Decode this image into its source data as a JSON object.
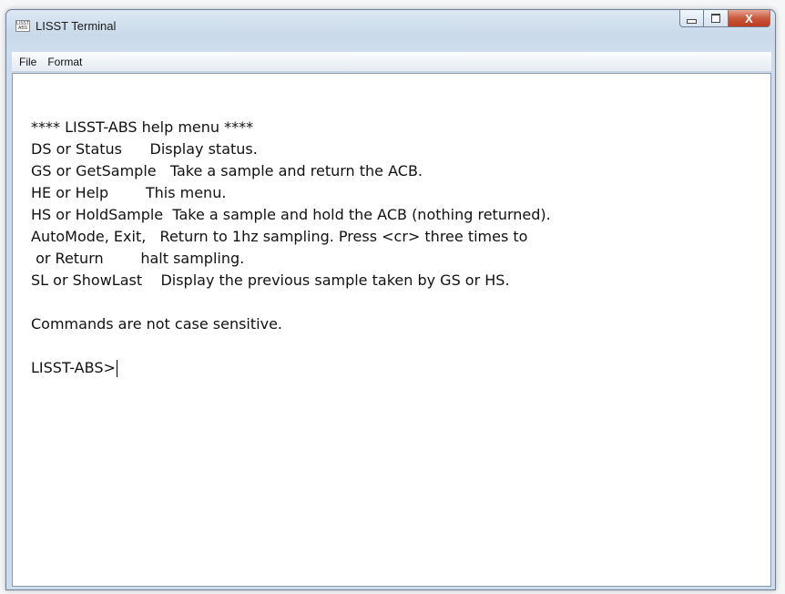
{
  "window": {
    "title": "LISST Terminal",
    "icon": "lisst-app-icon",
    "icon_label": "LISST ABS"
  },
  "caption_buttons": {
    "minimize": "minimize",
    "maximize": "maximize",
    "close": "X"
  },
  "menubar": {
    "file": "File",
    "format": "Format"
  },
  "terminal": {
    "lines": [
      "",
      "**** LISST-ABS help menu ****",
      "DS or Status      Display status.",
      "GS or GetSample   Take a sample and return the ACB.",
      "HE or Help        This menu.",
      "HS or HoldSample  Take a sample and hold the ACB (nothing returned).",
      "AutoMode, Exit,   Return to 1hz sampling. Press <cr> three times to",
      " or Return        halt sampling.",
      "SL or ShowLast    Display the previous sample taken by GS or HS.",
      "",
      "Commands are not case sensitive.",
      "",
      "LISST-ABS>"
    ]
  }
}
